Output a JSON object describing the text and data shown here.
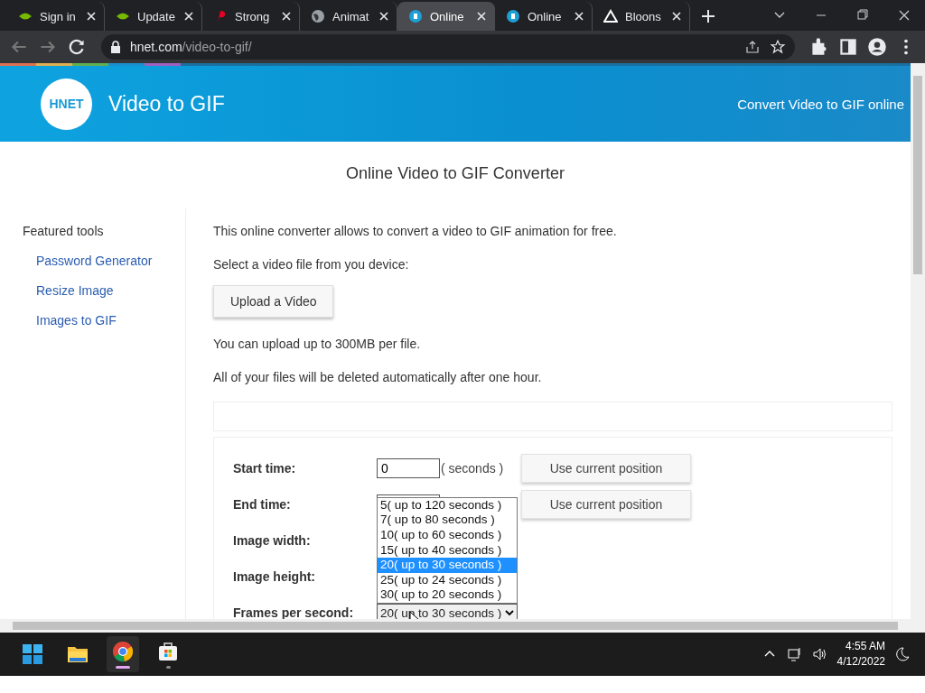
{
  "browser": {
    "tabs": [
      {
        "title": "Sign in",
        "kind": "eye",
        "selected": false
      },
      {
        "title": "Update",
        "kind": "eye",
        "selected": false
      },
      {
        "title": "Strong",
        "kind": "pin",
        "selected": false
      },
      {
        "title": "Animat",
        "kind": "globe",
        "selected": false
      },
      {
        "title": "Online",
        "kind": "disc",
        "selected": true
      },
      {
        "title": "Online",
        "kind": "disc",
        "selected": false
      },
      {
        "title": "Bloons",
        "kind": "triangle",
        "selected": false
      }
    ],
    "address": {
      "host": "hnet.com",
      "path": "/video-to-gif/"
    }
  },
  "header": {
    "logo": "HNET",
    "title": "Video to GIF",
    "tagline": "Convert Video to GIF online"
  },
  "page_title": "Online Video to GIF Converter",
  "sidebar": {
    "heading": "Featured tools",
    "links": [
      "Password Generator",
      "Resize Image",
      "Images to GIF"
    ]
  },
  "intro": [
    "This online converter allows to convert a video to GIF animation for free.",
    "Select a video file from you device:"
  ],
  "upload_button": "Upload a Video",
  "notes": [
    "You can upload up to 300MB per file.",
    "All of your files will be deleted automatically after one hour."
  ],
  "form": [
    {
      "kind": "time",
      "label": "Start time:",
      "value": "0",
      "suffix": "( seconds )",
      "button": "Use current position"
    },
    {
      "kind": "time",
      "label": "End time:",
      "button": "Use current position"
    },
    {
      "kind": "blank",
      "label": "Image width:"
    },
    {
      "kind": "blank",
      "label": "Image height:"
    },
    {
      "kind": "select",
      "label": "Frames per second:",
      "value": "20( up to 30 seconds )",
      "options": [
        {
          "text": "5( up to 120 seconds )",
          "selected": false
        },
        {
          "text": "7( up to 80 seconds )",
          "selected": false
        },
        {
          "text": "10( up to 60 seconds )",
          "selected": false
        },
        {
          "text": "15( up to 40 seconds )",
          "selected": false
        },
        {
          "text": "20( up to 30 seconds )",
          "selected": true
        },
        {
          "text": "25( up to 24 seconds )",
          "selected": false
        },
        {
          "text": "30( up to 20 seconds )",
          "selected": false
        }
      ]
    }
  ],
  "taskbar": {
    "apps": [
      {
        "kind": "windows",
        "active": false
      },
      {
        "kind": "folder",
        "active": false
      },
      {
        "kind": "browser",
        "active": true
      },
      {
        "kind": "store",
        "active": false
      }
    ],
    "time": "4:55 AM",
    "date": "4/12/2022"
  }
}
